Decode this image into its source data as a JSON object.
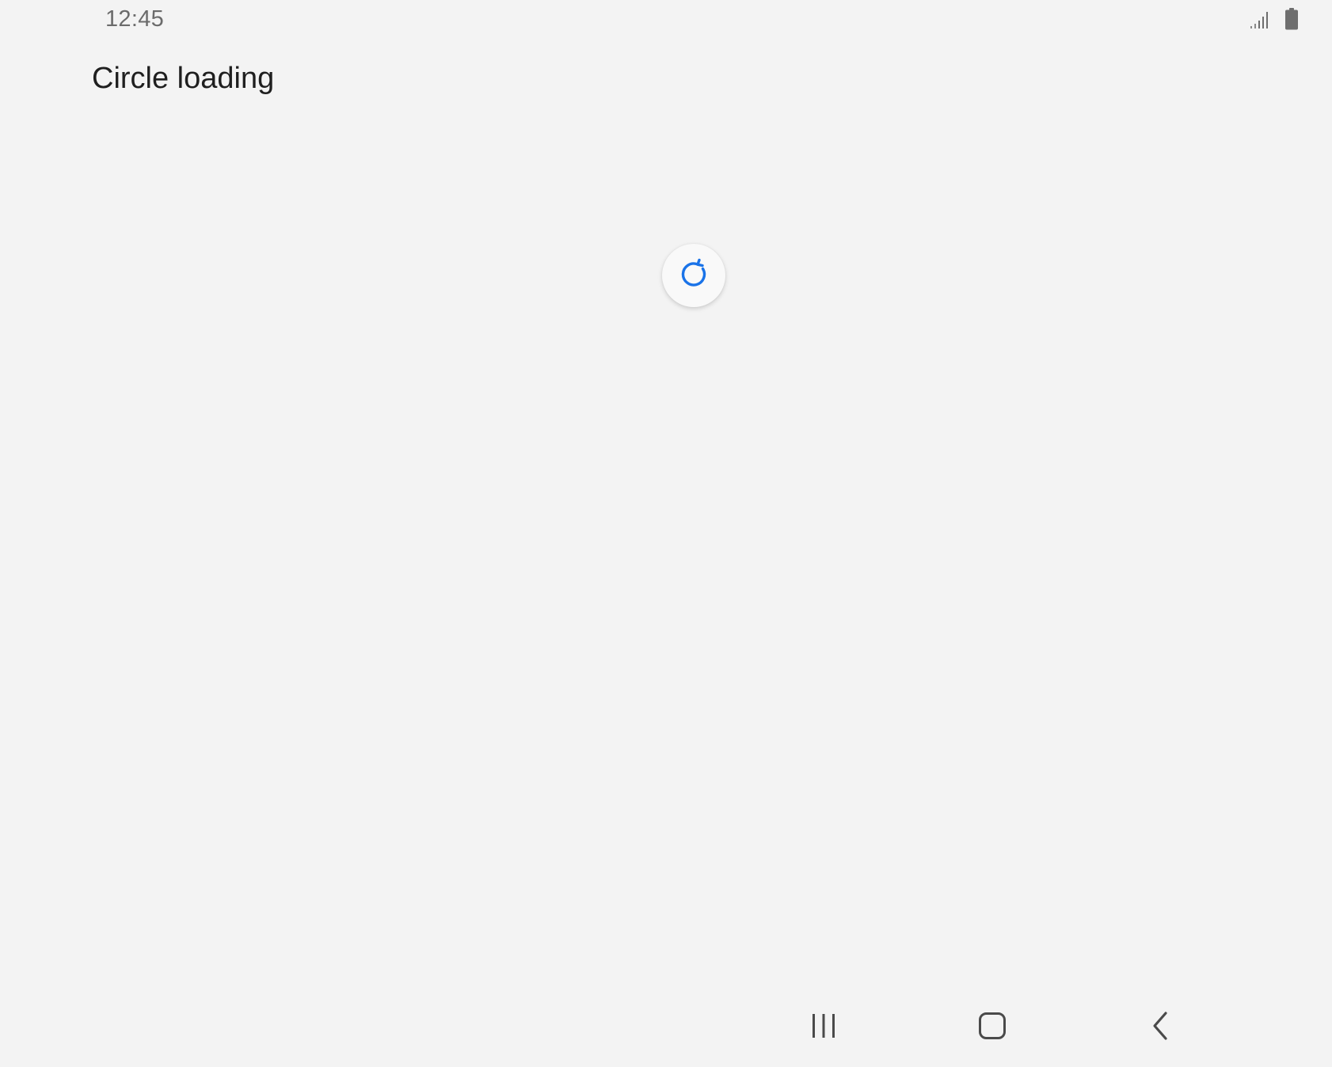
{
  "status_bar": {
    "time": "12:45",
    "icons": [
      "signal-icon",
      "battery-icon"
    ]
  },
  "app": {
    "title": "Circle loading"
  },
  "loader": {
    "icon": "refresh-icon",
    "accent_color": "#1a73e8"
  },
  "navigation": {
    "buttons": [
      "recents",
      "home",
      "back"
    ]
  },
  "colors": {
    "background": "#f3f3f3",
    "title_text": "#1f1f1f",
    "status_text": "#6b6b6b"
  }
}
